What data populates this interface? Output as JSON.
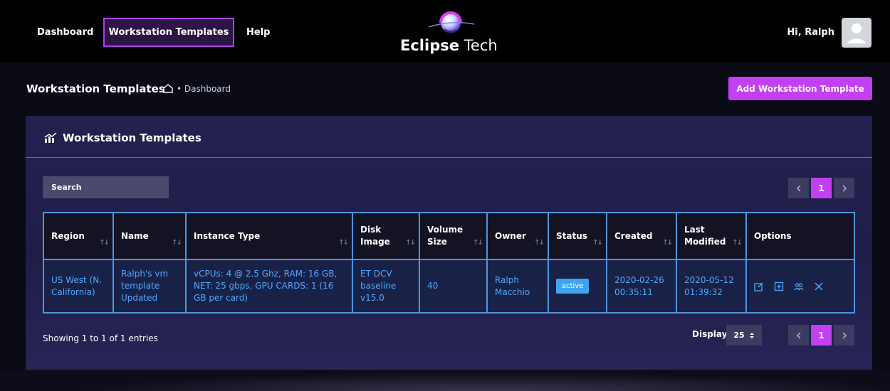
{
  "nav": {
    "links": [
      "Dashboard",
      "Workstation Templates",
      "Help"
    ],
    "active_index": 1,
    "brand_bold": "Eclipse",
    "brand_light": " Tech",
    "greeting": "Hi, Ralph",
    "accent_color": "#c23ff2"
  },
  "page": {
    "title": "Workstation Templates",
    "breadcrumb": "• Dashboard",
    "add_button": "Add Workstation Template"
  },
  "card": {
    "title": "Workstation Templates",
    "search_placeholder": "Search",
    "current_page": "1",
    "prev_icon": "chevron-left-icon",
    "next_icon": "chevron-right-icon"
  },
  "table": {
    "columns": [
      "Region",
      "Name",
      "Instance Type",
      "Disk Image",
      "Volume Size",
      "Owner",
      "Status",
      "Created",
      "Last Modified",
      "Options"
    ],
    "rows": [
      {
        "region": "US West (N. California)",
        "name": "Ralph's vm template Updated",
        "instance_type": "vCPUs: 4 @ 2.5 Ghz, RAM: 16 GB, NET: 25 gbps, GPU CARDS: 1 (16 GB per card)",
        "disk_image": "ET DCV baseline v15.0",
        "volume_size": "40",
        "owner": "Ralph Macchio",
        "status": "active",
        "created": "2020-02-26 00:35:11",
        "last_modified": "2020-05-12 01:39:32",
        "options": [
          "edit-icon",
          "add-box-icon",
          "users-icon",
          "close-icon"
        ]
      }
    ]
  },
  "footer": {
    "info": "Showing 1 to 1 of 1 entries",
    "display_label": "Display",
    "display_value": "25",
    "current_page": "1"
  }
}
